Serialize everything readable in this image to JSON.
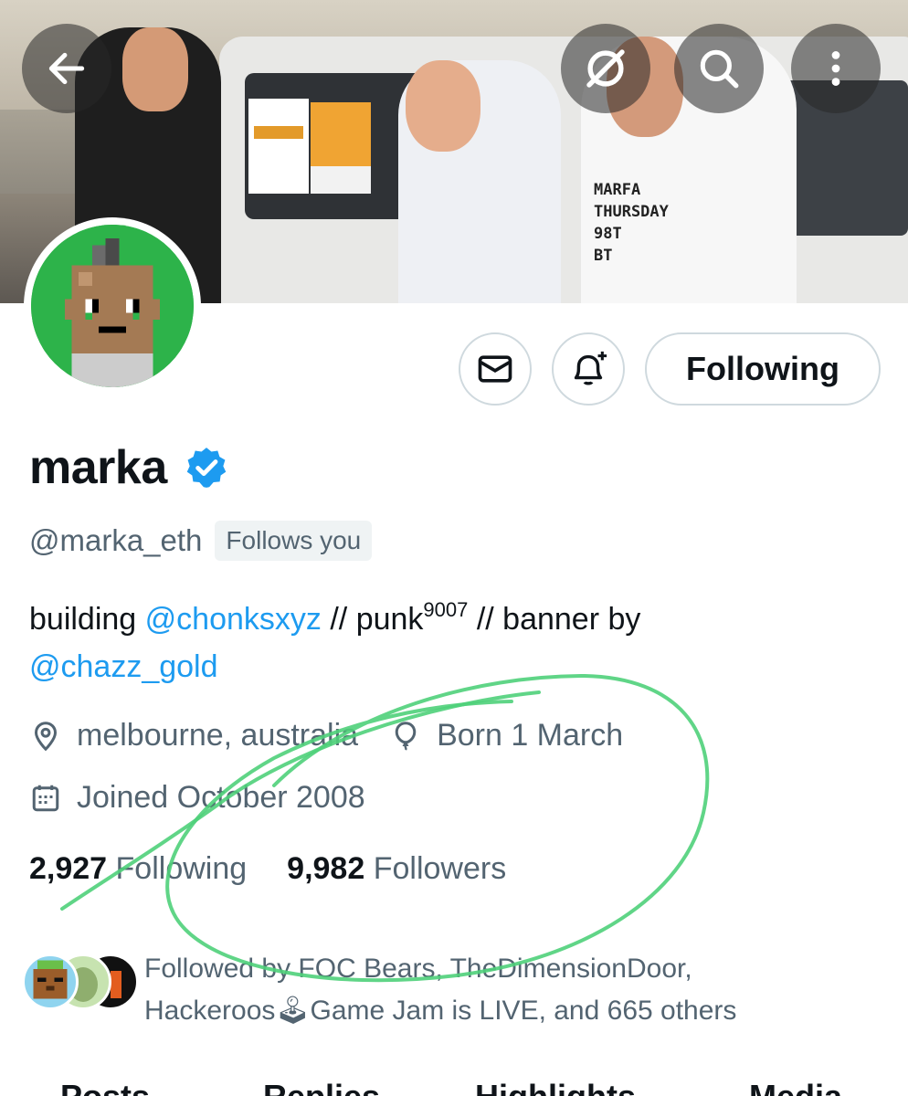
{
  "banner": {
    "shirt_text": [
      "MARFA",
      "THURSDAY",
      "98T",
      "BT"
    ],
    "overlay_buttons": [
      {
        "icon": "back-arrow-icon"
      },
      {
        "icon": "grok-icon"
      },
      {
        "icon": "search-icon"
      },
      {
        "icon": "more-vertical-icon"
      }
    ]
  },
  "actions": {
    "message_icon": "envelope-icon",
    "notify_icon": "bell-plus-icon",
    "follow_label": "Following"
  },
  "profile": {
    "name": "marka",
    "handle": "@marka_eth",
    "follows_you": "Follows you",
    "bio": {
      "prefix": "building ",
      "mention1": "@chonksxyz",
      "mid": " // punk",
      "sup": "9007",
      "suffix": " // banner by",
      "mention2": "@chazz_gold"
    },
    "location": "melbourne, australia",
    "birthday": "Born 1 March",
    "joined": "Joined October 2008"
  },
  "stats": {
    "following_count": "2,927",
    "following_label": " Following",
    "followers_count": "9,982",
    "followers_label": " Followers"
  },
  "followed_by": {
    "line1": "Followed by FOC Bears, TheDimensionDoor,",
    "line2_a": "Hackeroos",
    "line2_emoji": "🕹",
    "line2_b": "Game Jam is LIVE, and 665 others"
  },
  "tabs": [
    "Posts",
    "Replies",
    "Highlights",
    "Media"
  ],
  "colors": {
    "accent": "#1d9bf0",
    "text": "#0f1419",
    "muted": "#536471",
    "annotation": "#4fd07a"
  }
}
